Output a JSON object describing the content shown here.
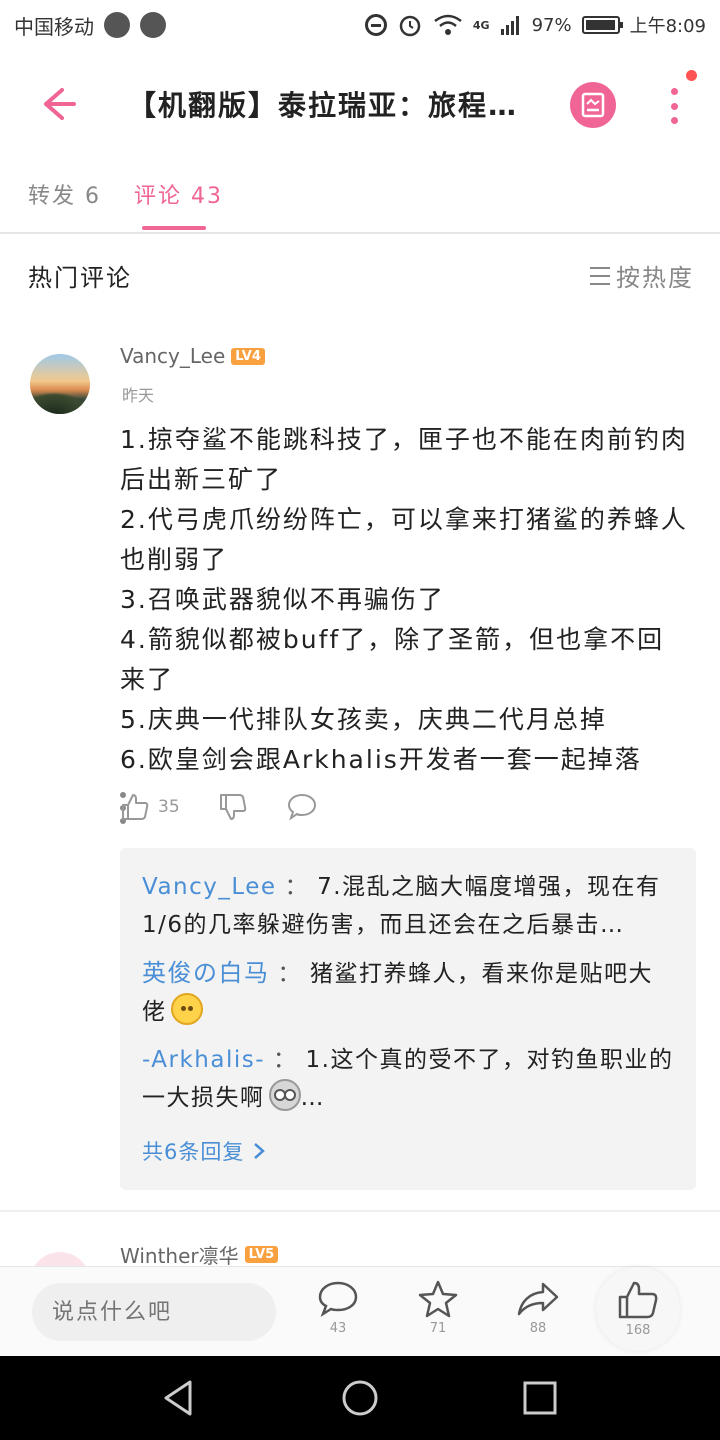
{
  "status_bar": {
    "carrier": "中国移动",
    "network": "4G",
    "battery": "97%",
    "battery_level": 0.97,
    "time": "上午8:09"
  },
  "header": {
    "title": "【机翻版】泰拉瑞亚：旅程…",
    "back_icon": "back-arrow-icon",
    "doc_icon": "document-icon",
    "more_icon": "more-vertical-icon",
    "accent": "#f06595"
  },
  "tabs": {
    "forward": "转发 6",
    "comments": "评论 43"
  },
  "hot": {
    "title": "热门评论",
    "sort": "按热度"
  },
  "comment": {
    "username": "Vancy_Lee",
    "level": "LV4",
    "time": "昨天",
    "lines": [
      "1.掠夺鲨不能跳科技了，匣子也不能在肉前钓肉后出新三矿了",
      "2.代弓虎爪纷纷阵亡，可以拿来打猪鲨的养蜂人也削弱了",
      "3.召唤武器貌似不再骗伤了",
      "4.箭貌似都被buff了，除了圣箭，但也拿不回来了",
      "5.庆典一代排队女孩卖，庆典二代月总掉",
      "6.欧皇剑会跟Arkhalis开发者一套一起掉落"
    ],
    "likes": "35"
  },
  "replies": [
    {
      "user": "Vancy_Lee",
      "sep": "：",
      "text": "7.混乱之脑大幅度增强，现在有1/6的几率躲避伤害，而且还会在之后暴击…"
    },
    {
      "user": "英俊の白马",
      "sep": "：",
      "text": "猪鲨打养蜂人，看来你是贴吧大佬"
    },
    {
      "user": "-Arkhalis-",
      "sep": "：",
      "text": "1.这个真的受不了，对钓鱼职业的一大损失啊"
    }
  ],
  "more_replies": "共6条回复",
  "next_comment": {
    "username": "Winther凛华",
    "level": "LV5"
  },
  "bottom_bar": {
    "placeholder": "说点什么吧",
    "comments": "43",
    "stars": "71",
    "shares": "88",
    "likes": "168"
  }
}
